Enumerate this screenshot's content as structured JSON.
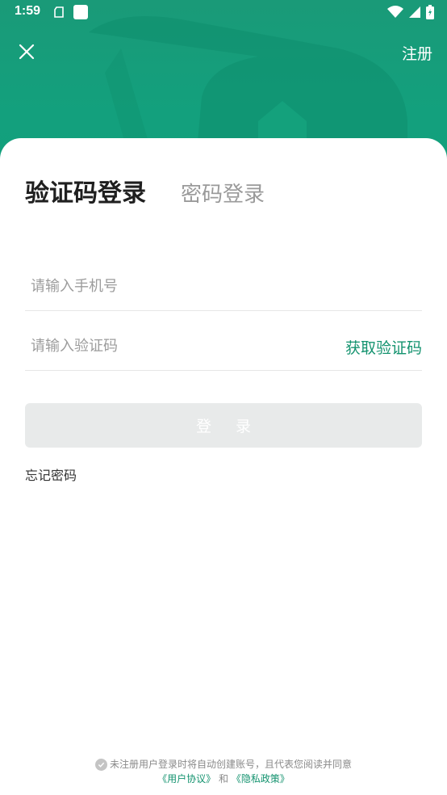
{
  "status_bar": {
    "time": "1:59"
  },
  "header": {
    "register_label": "注册",
    "close_icon": "close-icon"
  },
  "tabs": {
    "active": "验证码登录",
    "inactive": "密码登录"
  },
  "form": {
    "phone_placeholder": "请输入手机号",
    "code_placeholder": "请输入验证码",
    "get_code_label": "获取验证码",
    "login_label": "登 录",
    "forgot_label": "忘记密码"
  },
  "agreement": {
    "text": "未注册用户登录时将自动创建账号，且代表您阅读并同意",
    "user_agreement": "《用户协议》",
    "and": "和",
    "privacy_policy": "《隐私政策》"
  },
  "colors": {
    "brand": "#13a07d",
    "link": "#14936f",
    "button_disabled": "#e8eaea"
  }
}
